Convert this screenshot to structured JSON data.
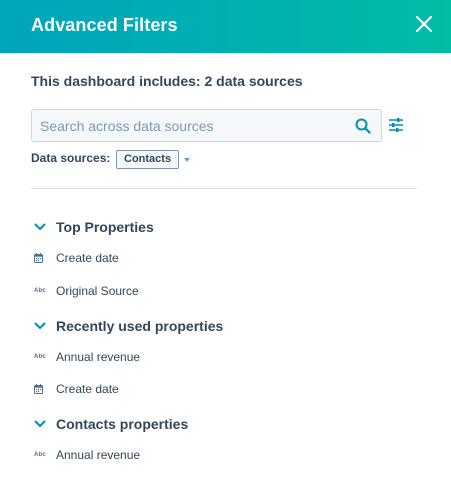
{
  "header": {
    "title": "Advanced Filters"
  },
  "panel": {
    "heading": "This dashboard includes: 2 data sources"
  },
  "search": {
    "placeholder": "Search across data sources",
    "value": ""
  },
  "data_sources": {
    "label": "Data sources:",
    "selected": "Contacts"
  },
  "sections": [
    {
      "label": "Top Properties"
    },
    {
      "label": "Recently used properties"
    },
    {
      "label": "Contacts properties"
    }
  ],
  "properties": [
    {
      "icon": "calendar-icon",
      "label": "Create date"
    },
    {
      "icon": "text-icon",
      "icon_text": "Abc",
      "label": "Original Source"
    },
    {
      "icon": "text-icon",
      "icon_text": "Abc",
      "label": "Annual revenue"
    },
    {
      "icon": "calendar-icon",
      "label": "Create date"
    },
    {
      "icon": "text-icon",
      "icon_text": "Abc",
      "label": "Annual revenue"
    }
  ],
  "colors": {
    "header_start": "#00a4bd",
    "header_end": "#00bda5",
    "accent": "#0091ae",
    "text": "#33475b"
  }
}
